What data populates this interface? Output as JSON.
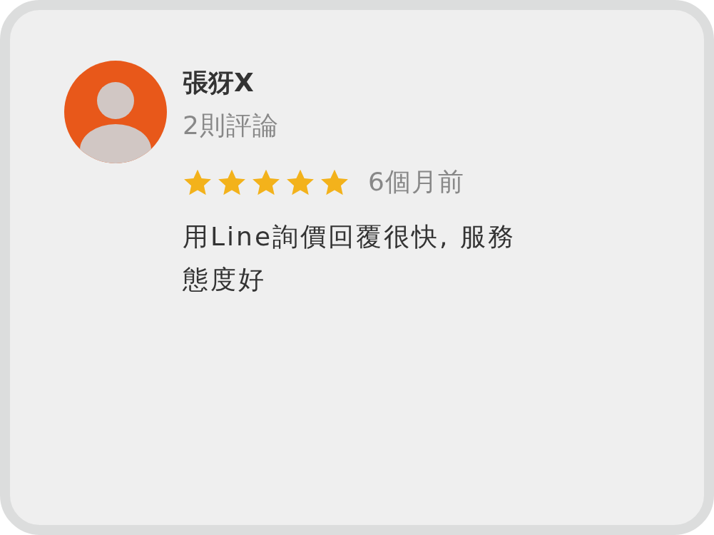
{
  "review": {
    "author": "張犽X",
    "review_count": "2則評論",
    "stars": 5,
    "time": "6個月前",
    "text": "用Line詢價回覆很快, 服務態度好"
  }
}
